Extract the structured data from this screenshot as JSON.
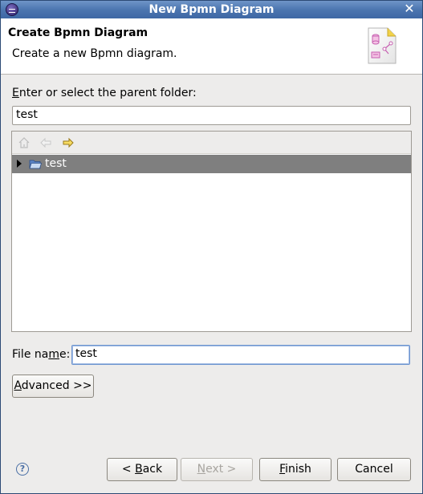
{
  "window": {
    "title": "New Bpmn Diagram"
  },
  "banner": {
    "title": "Create Bpmn Diagram",
    "description": "Create a new Bpmn diagram."
  },
  "parent_folder": {
    "label_mnemonic": "E",
    "label_rest": "nter or select the parent folder:",
    "value": "test"
  },
  "tree": {
    "toolbar": [
      {
        "name": "home-icon",
        "enabled": false
      },
      {
        "name": "back-arrow-icon",
        "enabled": false
      },
      {
        "name": "forward-arrow-icon",
        "enabled": true
      }
    ],
    "items": [
      {
        "label": "test",
        "selected": true,
        "expanded": false
      }
    ]
  },
  "file_name": {
    "label_pre": "File na",
    "label_mnemonic": "m",
    "label_post": "e:",
    "value": "test"
  },
  "advanced_button": {
    "mnemonic": "A",
    "rest": "dvanced >>"
  },
  "buttons": {
    "back": {
      "pre": "< ",
      "mnemonic": "B",
      "rest": "ack"
    },
    "next": {
      "pre": "",
      "mnemonic": "N",
      "rest": "ext >"
    },
    "finish": {
      "pre": "",
      "mnemonic": "F",
      "rest": "inish"
    },
    "cancel": {
      "label": "Cancel"
    }
  },
  "colors": {
    "title_bar": "#4c76b0",
    "selection": "#7f7f7f",
    "accent": "#6f96d0"
  }
}
